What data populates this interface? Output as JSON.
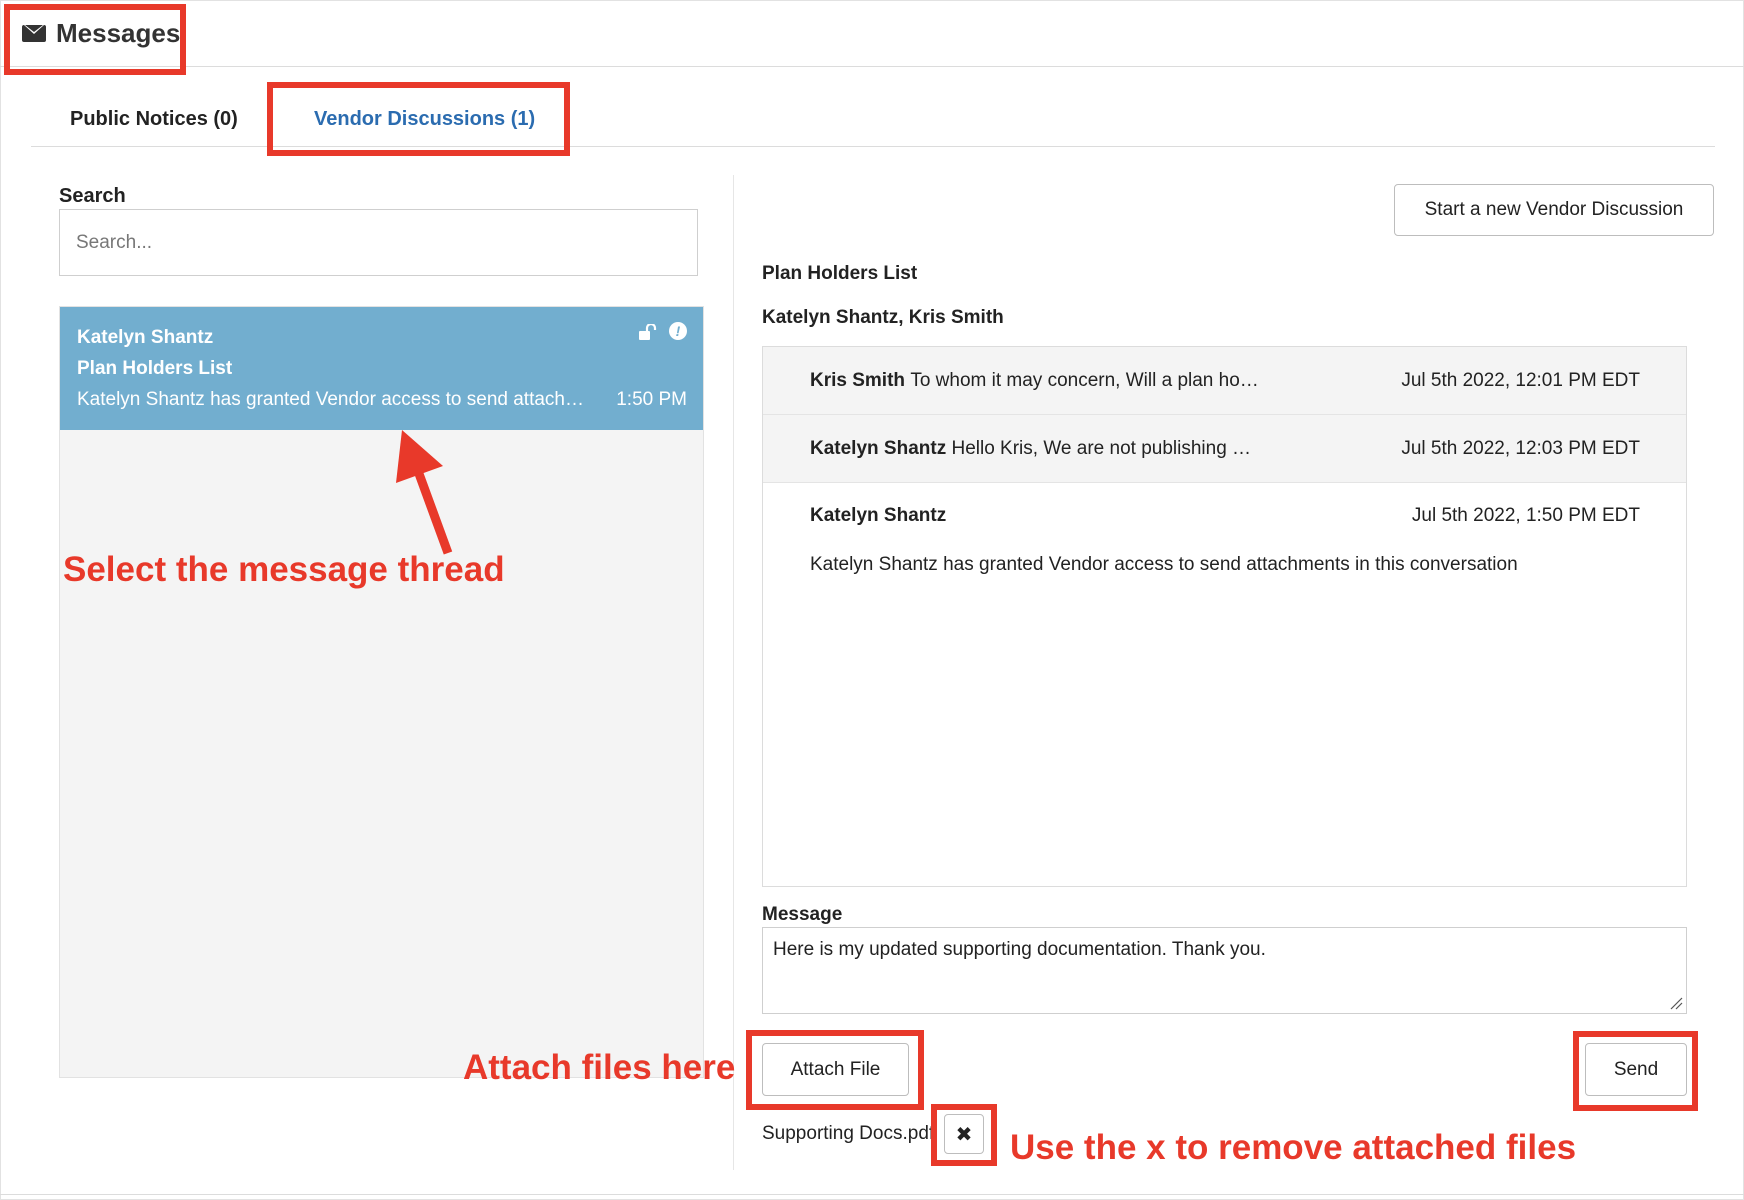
{
  "header": {
    "title": "Messages",
    "icon": "envelope-icon"
  },
  "tabs": [
    {
      "label": "Public Notices (0)",
      "active": false
    },
    {
      "label": "Vendor Discussions (1)",
      "active": true
    }
  ],
  "search": {
    "label": "Search",
    "placeholder": "Search..."
  },
  "threads": [
    {
      "name": "Katelyn Shantz",
      "subject": "Plan Holders List",
      "preview": "Katelyn Shantz has granted Vendor access to send attachments in this conversation",
      "time": "1:50 PM",
      "selected": true
    }
  ],
  "new_discussion_label": "Start a new Vendor Discussion",
  "conversation": {
    "title": "Plan Holders List",
    "participants": "Katelyn Shantz, Kris Smith",
    "messages": [
      {
        "sender": "Kris Smith",
        "snippet": "To whom it may concern, Will a plan ho…",
        "date": "Jul 5th 2022, 12:01 PM EDT",
        "expanded": false
      },
      {
        "sender": "Katelyn Shantz",
        "snippet": "Hello Kris, We are not publishing …",
        "date": "Jul 5th 2022, 12:03 PM EDT",
        "expanded": false
      },
      {
        "sender": "Katelyn Shantz",
        "body": "Katelyn Shantz has granted Vendor access to send attachments in this conversation",
        "date": "Jul 5th 2022, 1:50 PM EDT",
        "expanded": true
      }
    ]
  },
  "compose": {
    "label": "Message",
    "value": "Here is my updated supporting documentation. Thank you.",
    "attach_label": "Attach File",
    "send_label": "Send",
    "attached_file": "Supporting Docs.pdf",
    "remove_symbol": "✖"
  },
  "annotations": {
    "select_thread": "Select the message thread",
    "attach_files": "Attach files here",
    "remove_files": "Use the x to remove attached files"
  },
  "colors": {
    "accent_red": "#e8392a",
    "selected_thread": "#72aecf",
    "active_tab": "#2b6cb0"
  }
}
